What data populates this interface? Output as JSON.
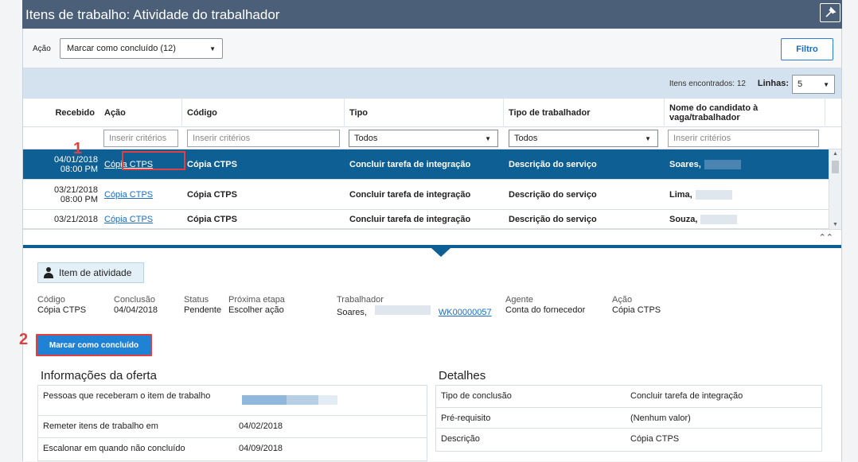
{
  "window": {
    "title": "Itens de trabalho: Atividade do trabalhador"
  },
  "actionbar": {
    "action_label": "Ação",
    "action_value": "Marcar como concluído (12)",
    "filter_button": "Filtro"
  },
  "countbar": {
    "found": "Itens encontrados: 12",
    "rows_label": "Linhas:",
    "rows_value": "5"
  },
  "table": {
    "headers": [
      "Recebido",
      "Ação",
      "Código",
      "Tipo",
      "Tipo de trabalhador",
      "Nome do candidato à vaga/trabalhador"
    ],
    "filters": {
      "acao_placeholder": "Inserir critérios",
      "codigo_placeholder": "Inserir critérios",
      "tipo_value": "Todos",
      "tipo_trab_value": "Todos",
      "nome_placeholder": "Inserir critérios"
    },
    "rows": [
      {
        "date": "04/01/2018",
        "time": "08:00 PM",
        "acao": "Cópia CTPS",
        "codigo": "Cópia CTPS",
        "tipo": "Concluir tarefa de integração",
        "tipo_trab": "Descrição do serviço",
        "nome": "Soares,"
      },
      {
        "date": "03/21/2018",
        "time": "08:00 PM",
        "acao": "Cópia CTPS",
        "codigo": "Cópia CTPS",
        "tipo": "Concluir tarefa de integração",
        "tipo_trab": "Descrição do serviço",
        "nome": "Lima,"
      },
      {
        "date": "03/21/2018",
        "time": "",
        "acao": "Cópia CTPS",
        "codigo": "Cópia CTPS",
        "tipo": "Concluir tarefa de integração",
        "tipo_trab": "Descrição do serviço",
        "nome": "Souza,"
      }
    ]
  },
  "detail": {
    "badge": "Item de atividade",
    "fields": [
      {
        "k": "Código",
        "v": "Cópia CTPS"
      },
      {
        "k": "Conclusão",
        "v": "04/04/2018"
      },
      {
        "k": "Status",
        "v": "Pendente"
      },
      {
        "k": "Próxima etapa",
        "v": "Escolher ação"
      },
      {
        "k": "Trabalhador",
        "v": "Soares,",
        "link": "WK00000057"
      },
      {
        "k": "Agente",
        "v": "Conta do fornecedor"
      },
      {
        "k": "Ação",
        "v": "Cópia CTPS"
      }
    ],
    "mark_button": "Marcar como concluído"
  },
  "callouts": {
    "one": "1",
    "two": "2"
  },
  "offer": {
    "title": "Informações da oferta",
    "rows": [
      {
        "label": "Pessoas que receberam o item de trabalho",
        "value": ""
      },
      {
        "label": "Remeter itens de trabalho em",
        "value": "04/02/2018"
      },
      {
        "label": "Escalonar em quando não concluído",
        "value": "04/09/2018"
      }
    ]
  },
  "details_panel": {
    "title": "Detalhes",
    "rows": [
      {
        "label": "Tipo de conclusão",
        "value": "Concluir tarefa de integração"
      },
      {
        "label": "Pré-requisito",
        "value": "(Nenhum valor)"
      },
      {
        "label": "Descrição",
        "value": "Cópia CTPS"
      }
    ]
  }
}
